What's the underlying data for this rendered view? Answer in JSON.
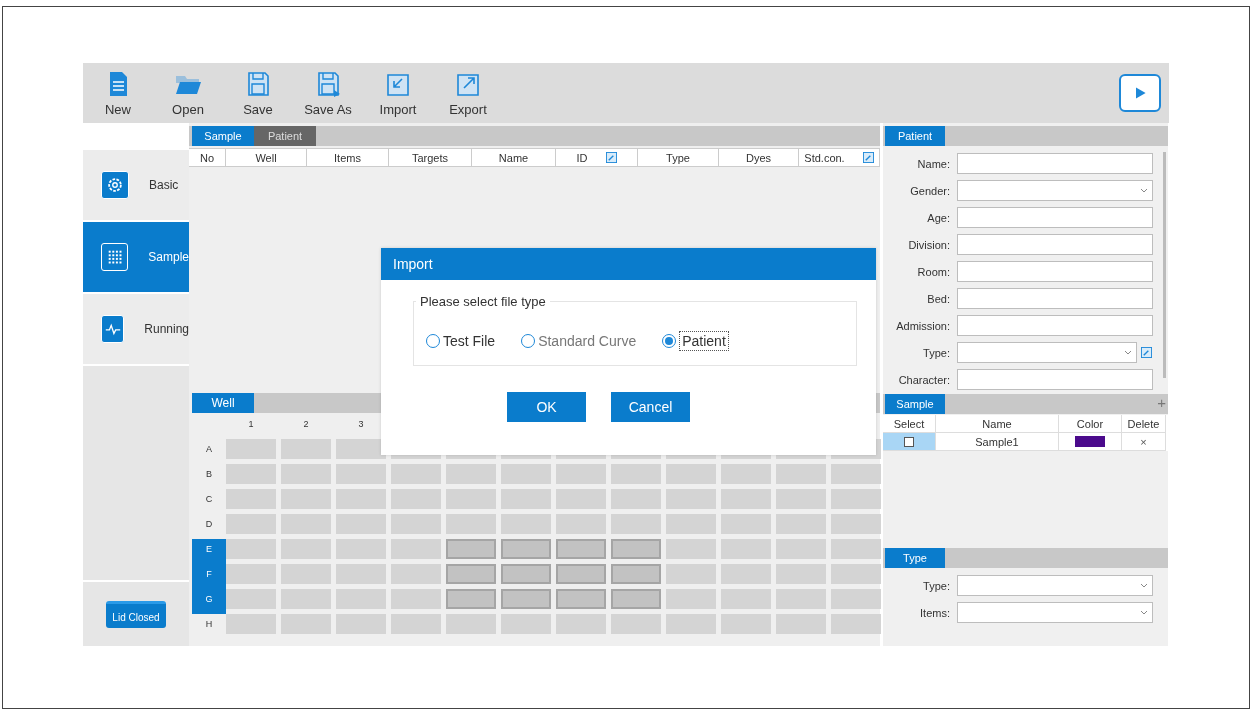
{
  "toolbar": {
    "items": [
      {
        "label": "New"
      },
      {
        "label": "Open"
      },
      {
        "label": "Save"
      },
      {
        "label": "Save As"
      },
      {
        "label": "Import"
      },
      {
        "label": "Export"
      }
    ]
  },
  "sidebar": {
    "items": [
      {
        "label": "Basic",
        "selected": false
      },
      {
        "label": "Sample",
        "selected": true
      },
      {
        "label": "Running",
        "selected": false
      }
    ],
    "status": "Lid Closed"
  },
  "tabs": [
    {
      "label": "Sample",
      "selected": true
    },
    {
      "label": "Patient",
      "selected": false
    }
  ],
  "table": {
    "columns": [
      {
        "label": "No",
        "editable": false
      },
      {
        "label": "Well",
        "editable": false
      },
      {
        "label": "Items",
        "editable": false
      },
      {
        "label": "Targets",
        "editable": false
      },
      {
        "label": "Name",
        "editable": false
      },
      {
        "label": "ID",
        "editable": true
      },
      {
        "label": "Type",
        "editable": false
      },
      {
        "label": "Dyes",
        "editable": false
      },
      {
        "label": "Std.con.",
        "editable": true
      }
    ]
  },
  "well": {
    "title": "Well",
    "columns": [
      "1",
      "2",
      "3"
    ],
    "rows": [
      {
        "label": "A",
        "selected": false,
        "cells": [
          false,
          false,
          false,
          false,
          false,
          false,
          false,
          false,
          false,
          false,
          false,
          false
        ]
      },
      {
        "label": "B",
        "selected": false,
        "cells": [
          false,
          false,
          false,
          false,
          false,
          false,
          false,
          false,
          false,
          false,
          false,
          false
        ]
      },
      {
        "label": "C",
        "selected": false,
        "cells": [
          false,
          false,
          false,
          false,
          false,
          false,
          false,
          false,
          false,
          false,
          false,
          false
        ]
      },
      {
        "label": "D",
        "selected": false,
        "cells": [
          false,
          false,
          false,
          false,
          false,
          false,
          false,
          false,
          false,
          false,
          false,
          false
        ]
      },
      {
        "label": "E",
        "selected": true,
        "cells": [
          false,
          false,
          false,
          false,
          true,
          true,
          true,
          true,
          false,
          false,
          false,
          false
        ]
      },
      {
        "label": "F",
        "selected": true,
        "cells": [
          false,
          false,
          false,
          false,
          true,
          true,
          true,
          true,
          false,
          false,
          false,
          false
        ]
      },
      {
        "label": "G",
        "selected": true,
        "cells": [
          false,
          false,
          false,
          false,
          true,
          true,
          true,
          true,
          false,
          false,
          false,
          false
        ]
      },
      {
        "label": "H",
        "selected": false,
        "cells": [
          false,
          false,
          false,
          false,
          false,
          false,
          false,
          false,
          false,
          false,
          false,
          false
        ]
      }
    ]
  },
  "patient": {
    "title": "Patient",
    "fields": [
      {
        "label": "Name:",
        "kind": "text"
      },
      {
        "label": "Gender:",
        "kind": "dropdown"
      },
      {
        "label": "Age:",
        "kind": "text"
      },
      {
        "label": "Division:",
        "kind": "text"
      },
      {
        "label": "Room:",
        "kind": "text"
      },
      {
        "label": "Bed:",
        "kind": "text"
      },
      {
        "label": "Admission:",
        "kind": "text"
      },
      {
        "label": "Type:",
        "kind": "dropdown-edit"
      },
      {
        "label": "Character:",
        "kind": "text"
      }
    ]
  },
  "samples": {
    "title": "Sample",
    "add": "+",
    "columns": [
      "Select",
      "Name",
      "Color",
      "Delete"
    ],
    "rows": [
      {
        "checked": false,
        "name": "Sample1",
        "color": "#4b0a8c",
        "delete": "×"
      }
    ]
  },
  "type_panel": {
    "title": "Type",
    "fields": [
      {
        "label": "Type:",
        "kind": "dropdown"
      },
      {
        "label": "Items:",
        "kind": "dropdown"
      }
    ]
  },
  "dialog": {
    "title": "Import",
    "group": "Please select file type",
    "options": [
      {
        "label": "Test File",
        "selected": false
      },
      {
        "label": "Standard Curve",
        "selected": false
      },
      {
        "label": "Patient",
        "selected": true
      }
    ],
    "buttons": [
      "OK",
      "Cancel"
    ]
  }
}
